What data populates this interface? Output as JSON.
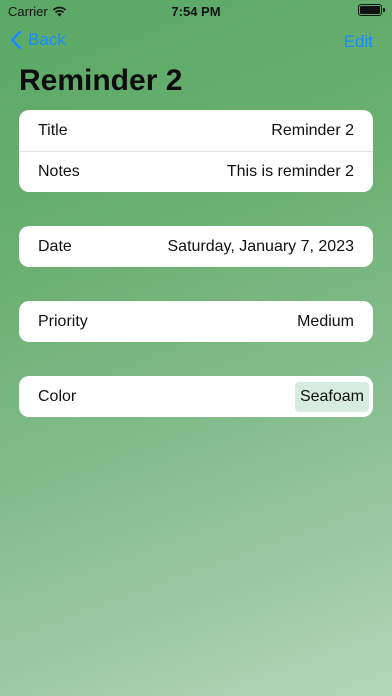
{
  "status_bar": {
    "carrier": "Carrier",
    "time": "7:54 PM"
  },
  "nav": {
    "back_label": "Back",
    "edit_label": "Edit"
  },
  "page_title": "Reminder 2",
  "details": {
    "title_label": "Title",
    "title_value": "Reminder 2",
    "notes_label": "Notes",
    "notes_value": "This is reminder 2"
  },
  "date": {
    "label": "Date",
    "value": "Saturday, January 7, 2023"
  },
  "priority": {
    "label": "Priority",
    "value": "Medium"
  },
  "color": {
    "label": "Color",
    "value": "Seafoam",
    "swatch": "#d6ece1"
  },
  "colors": {
    "accent": "#1a8cff"
  }
}
